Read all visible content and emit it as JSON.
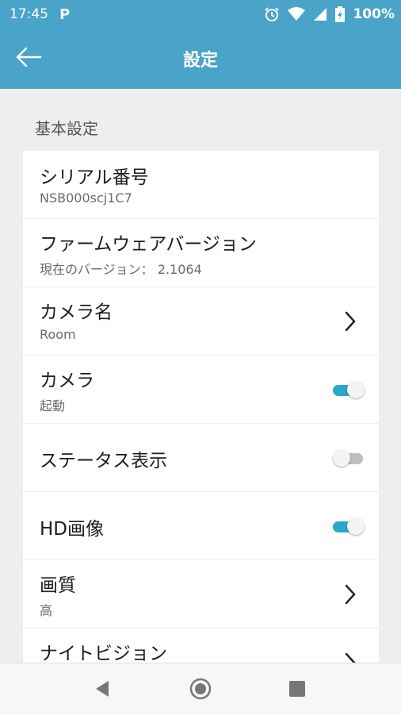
{
  "status_bar": {
    "time": "17:45",
    "app_icon": "P",
    "battery": "100%",
    "icons": [
      "alarm-icon",
      "wifi-icon",
      "signal-icon",
      "battery-icon"
    ]
  },
  "app_bar": {
    "title": "設定",
    "back_icon": "arrow-left-icon"
  },
  "section": {
    "header": "基本設定"
  },
  "rows": [
    {
      "title": "シリアル番号",
      "subtitle": "NSB000scj1C7",
      "control": "none"
    },
    {
      "title": "ファームウェアバージョン",
      "subtitle": "現在のバージョン： 2.1064",
      "control": "none"
    },
    {
      "title": "カメラ名",
      "subtitle": "Room",
      "control": "chevron"
    },
    {
      "title": "カメラ",
      "subtitle": "起動",
      "control": "toggle",
      "checked": true
    },
    {
      "title": "ステータス表示",
      "subtitle": "",
      "control": "toggle",
      "checked": false
    },
    {
      "title": "HD画像",
      "subtitle": "",
      "control": "toggle",
      "checked": true
    },
    {
      "title": "画質",
      "subtitle": "高",
      "control": "chevron"
    },
    {
      "title": "ナイトビジョン",
      "subtitle": "",
      "control": "chevron"
    }
  ],
  "colors": {
    "primary": "#4aa3c8",
    "toggle_on": "#2aa7c9",
    "toggle_off": "#bdbdbd",
    "background": "#eeeeee"
  },
  "nav_bar": {
    "icons": [
      "back-triangle-icon",
      "home-circle-icon",
      "recents-square-icon"
    ]
  }
}
